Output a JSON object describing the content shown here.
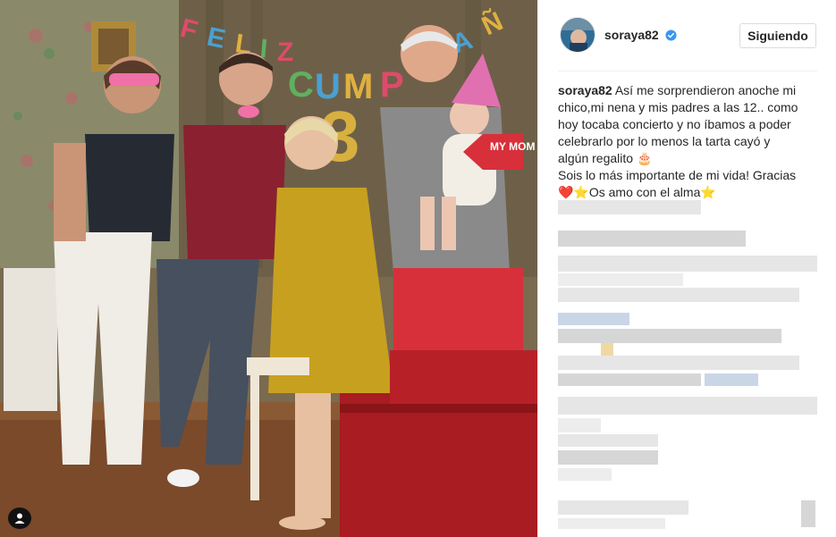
{
  "post": {
    "username": "soraya82",
    "follow_label": "Siguiendo",
    "caption_lines": [
      "Así me sorprendieron anoche mi",
      "chico,mi nena y mis padres a las 12.. como",
      "hoy tocaba concierto y no íbamos a poder",
      "celebrarlo por lo menos la tarta cayó y",
      "algún regalito 🎂",
      "Sois lo más importante de mi vida! Gracias",
      "❤️⭐Os amo con el alma⭐"
    ]
  },
  "photo": {
    "banner_text": "FELIZ CUMPLEAÑOS",
    "sign_text": "MY MOM",
    "icons": [
      "user-tag-icon"
    ]
  },
  "colors": {
    "verified": "#3897f0",
    "border": "#dbdbdb"
  }
}
